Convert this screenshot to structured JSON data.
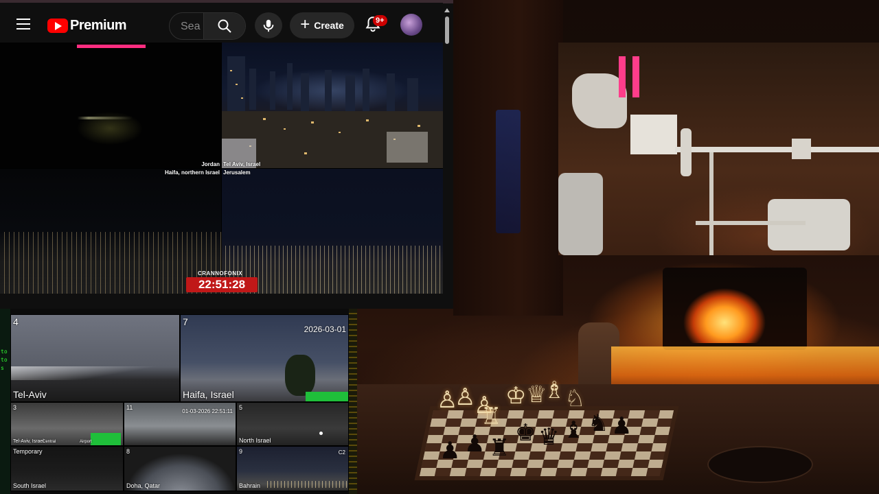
{
  "youtube": {
    "logo_text": "Premium",
    "search": {
      "placeholder": "Sea"
    },
    "create_label": "Create",
    "notifications_badge": "9+",
    "colors": {
      "brand_red": "#ff0000",
      "badge_red": "#cc0000",
      "bg": "#0f0f0f"
    },
    "icons": [
      "menu-icon",
      "youtube-logo-icon",
      "search-icon",
      "mic-icon",
      "plus-icon",
      "bell-icon",
      "avatar"
    ]
  },
  "live_grid": {
    "feeds": [
      {
        "label": "Jordan"
      },
      {
        "label": "Tel Aviv, Israel"
      },
      {
        "label": "Haifa, northern Israel"
      },
      {
        "label": "Jerusalem"
      }
    ],
    "brand": "CRANNOFONIX",
    "clock": "22:51:28"
  },
  "camera_mosaic": {
    "left_strip": [
      "to",
      "to",
      "s"
    ],
    "cams": [
      {
        "number": "4",
        "label": "Tel-Aviv"
      },
      {
        "number": "7",
        "label": "Haifa, Israel",
        "date": "2026-03-01"
      },
      {
        "number": "3",
        "label": "Tel-Aviv, Israel",
        "extra": [
          "Central",
          "Airport"
        ]
      },
      {
        "number": "11",
        "label": "",
        "date": "01-03-2026 22:51:11"
      },
      {
        "number": "5",
        "label": "North Israel"
      },
      {
        "number": "",
        "label": "South Israel",
        "top_label": "Temporary"
      },
      {
        "number": "8",
        "label": "Doha, Qatar"
      },
      {
        "number": "9",
        "label": "Bahrain",
        "corner": "C2"
      }
    ]
  }
}
